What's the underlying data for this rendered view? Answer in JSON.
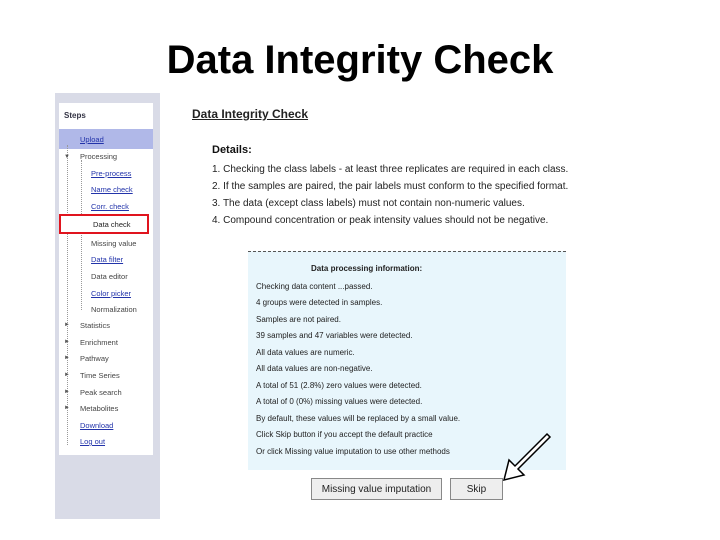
{
  "slide": {
    "title": "Data Integrity Check"
  },
  "sidebar": {
    "title": "Steps",
    "items": [
      {
        "label": "Upload",
        "arrow": ""
      },
      {
        "label": "Processing",
        "arrow": "▼"
      },
      {
        "label": "Pre-process",
        "arrow": ""
      },
      {
        "label": "Name check",
        "arrow": ""
      },
      {
        "label": "Corr. check",
        "arrow": ""
      },
      {
        "label": "Data check",
        "arrow": ""
      },
      {
        "label": "Missing value",
        "arrow": ""
      },
      {
        "label": "Data filter",
        "arrow": ""
      },
      {
        "label": "Data editor",
        "arrow": ""
      },
      {
        "label": "Color picker",
        "arrow": ""
      },
      {
        "label": "Normalization",
        "arrow": ""
      },
      {
        "label": "Statistics",
        "arrow": "►"
      },
      {
        "label": "Enrichment",
        "arrow": "►"
      },
      {
        "label": "Pathway",
        "arrow": "►"
      },
      {
        "label": "Time Series",
        "arrow": "►"
      },
      {
        "label": "Peak search",
        "arrow": "►"
      },
      {
        "label": "Metabolites",
        "arrow": "►"
      },
      {
        "label": "Download",
        "arrow": ""
      },
      {
        "label": "Log out",
        "arrow": ""
      }
    ]
  },
  "main": {
    "title": "Data Integrity Check",
    "details_label": "Details:",
    "details": [
      "1. Checking the class labels - at least three replicates are required in each class.",
      "2. If the samples are paired, the pair labels must conform to the specified format.",
      "3. The data (except class labels) must not contain non-numeric values.",
      "4. Compound concentration or peak intensity values should not be negative."
    ],
    "info": {
      "title": "Data processing information:",
      "lines": [
        "Checking data content ...passed.",
        "4 groups were detected in samples.",
        "Samples are not paired.",
        "39 samples and 47 variables were detected.",
        "All data values are numeric.",
        "All data values are non-negative.",
        "A total of 51 (2.8%) zero values were detected.",
        "A total of 0 (0%) missing values were detected.",
        "By default, these values will be replaced by a small value.",
        "Click Skip button if you accept the default practice",
        "Or click Missing value imputation to use other methods"
      ]
    },
    "buttons": {
      "missing": "Missing value imputation",
      "skip": "Skip"
    }
  },
  "colors": {
    "frame": "#d9dbe7",
    "highlight_box": "#e0141e",
    "info_bg": "#e8f6fc",
    "upload_bar": "#b0b8e8"
  }
}
